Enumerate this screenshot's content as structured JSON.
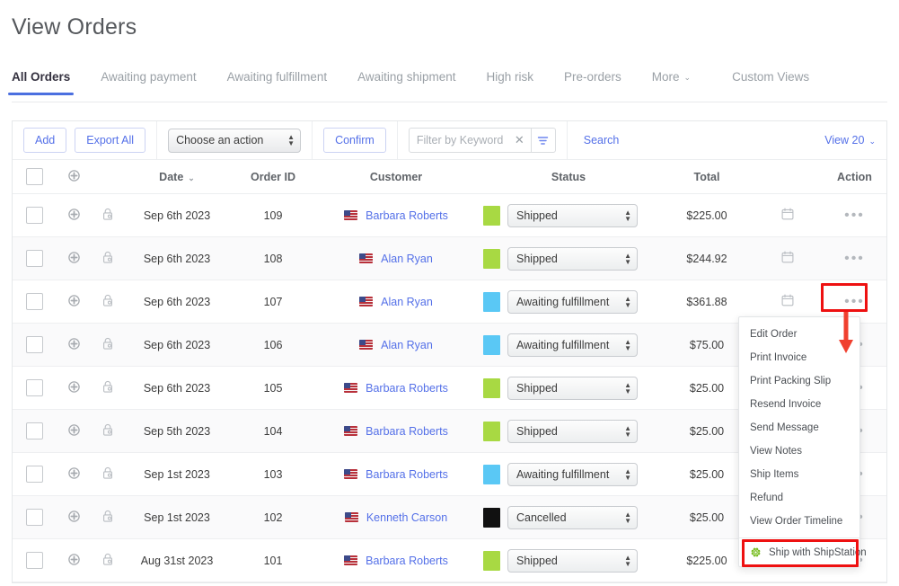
{
  "header": {
    "title": "View Orders"
  },
  "tabs": [
    {
      "label": "All Orders",
      "active": true
    },
    {
      "label": "Awaiting payment",
      "active": false
    },
    {
      "label": "Awaiting fulfillment",
      "active": false
    },
    {
      "label": "Awaiting shipment",
      "active": false
    },
    {
      "label": "High risk",
      "active": false
    },
    {
      "label": "Pre-orders",
      "active": false
    },
    {
      "label": "More",
      "active": false,
      "caret": "⌄"
    },
    {
      "label": "Custom Views",
      "active": false
    }
  ],
  "toolbar": {
    "add_label": "Add",
    "export_label": "Export All",
    "action_select_value": "Choose an action",
    "confirm_label": "Confirm",
    "filter_placeholder": "Filter by Keyword",
    "filter_value": "",
    "clear_icon": "✕",
    "funnel_icon": "filter-icon",
    "search_label": "Search",
    "view_label": "View 20",
    "view_caret": "⌄"
  },
  "table": {
    "columns": [
      "",
      "",
      "",
      "Date",
      "Order ID",
      "Customer",
      "Status",
      "Total",
      "",
      "Action"
    ],
    "headers": {
      "date": "Date",
      "order_id": "Order ID",
      "customer": "Customer",
      "status": "Status",
      "total": "Total",
      "action": "Action"
    },
    "sort_caret": "⌄",
    "dots": "•••",
    "rows": [
      {
        "date": "Sep 6th 2023",
        "order_id": "109",
        "customer": "Barbara Roberts",
        "flag": "us-flag-icon",
        "status": "Shipped",
        "status_color": "#a8d943",
        "total": "$225.00"
      },
      {
        "date": "Sep 6th 2023",
        "order_id": "108",
        "customer": "Alan Ryan",
        "flag": "us-flag-icon",
        "status": "Shipped",
        "status_color": "#a8d943",
        "total": "$244.92"
      },
      {
        "date": "Sep 6th 2023",
        "order_id": "107",
        "customer": "Alan Ryan",
        "flag": "us-flag-icon",
        "status": "Awaiting fulfillment",
        "status_color": "#5ac8f5",
        "total": "$361.88"
      },
      {
        "date": "Sep 6th 2023",
        "order_id": "106",
        "customer": "Alan Ryan",
        "flag": "us-flag-icon",
        "status": "Awaiting fulfillment",
        "status_color": "#5ac8f5",
        "total": "$75.00"
      },
      {
        "date": "Sep 6th 2023",
        "order_id": "105",
        "customer": "Barbara Roberts",
        "flag": "us-flag-icon",
        "status": "Shipped",
        "status_color": "#a8d943",
        "total": "$25.00"
      },
      {
        "date": "Sep 5th 2023",
        "order_id": "104",
        "customer": "Barbara Roberts",
        "flag": "us-flag-icon",
        "status": "Shipped",
        "status_color": "#a8d943",
        "total": "$25.00"
      },
      {
        "date": "Sep 1st 2023",
        "order_id": "103",
        "customer": "Barbara Roberts",
        "flag": "us-flag-icon",
        "status": "Awaiting fulfillment",
        "status_color": "#5ac8f5",
        "total": "$25.00"
      },
      {
        "date": "Sep 1st 2023",
        "order_id": "102",
        "customer": "Kenneth Carson",
        "flag": "us-flag-icon",
        "status": "Cancelled",
        "status_color": "#111111",
        "total": "$25.00"
      },
      {
        "date": "Aug 31st 2023",
        "order_id": "101",
        "customer": "Barbara Roberts",
        "flag": "us-flag-icon",
        "status": "Shipped",
        "status_color": "#a8d943",
        "total": "$225.00"
      }
    ]
  },
  "action_menu": {
    "items": [
      "Edit Order",
      "Print Invoice",
      "Print Packing Slip",
      "Resend Invoice",
      "Send Message",
      "View Notes",
      "Ship Items",
      "Refund",
      "View Order Timeline"
    ],
    "ship_label": "Ship with ShipStation",
    "ship_icon": "gear-icon"
  },
  "annotations": {
    "highlight_color": "#ee1111",
    "arrow_color": "#f0402f"
  }
}
